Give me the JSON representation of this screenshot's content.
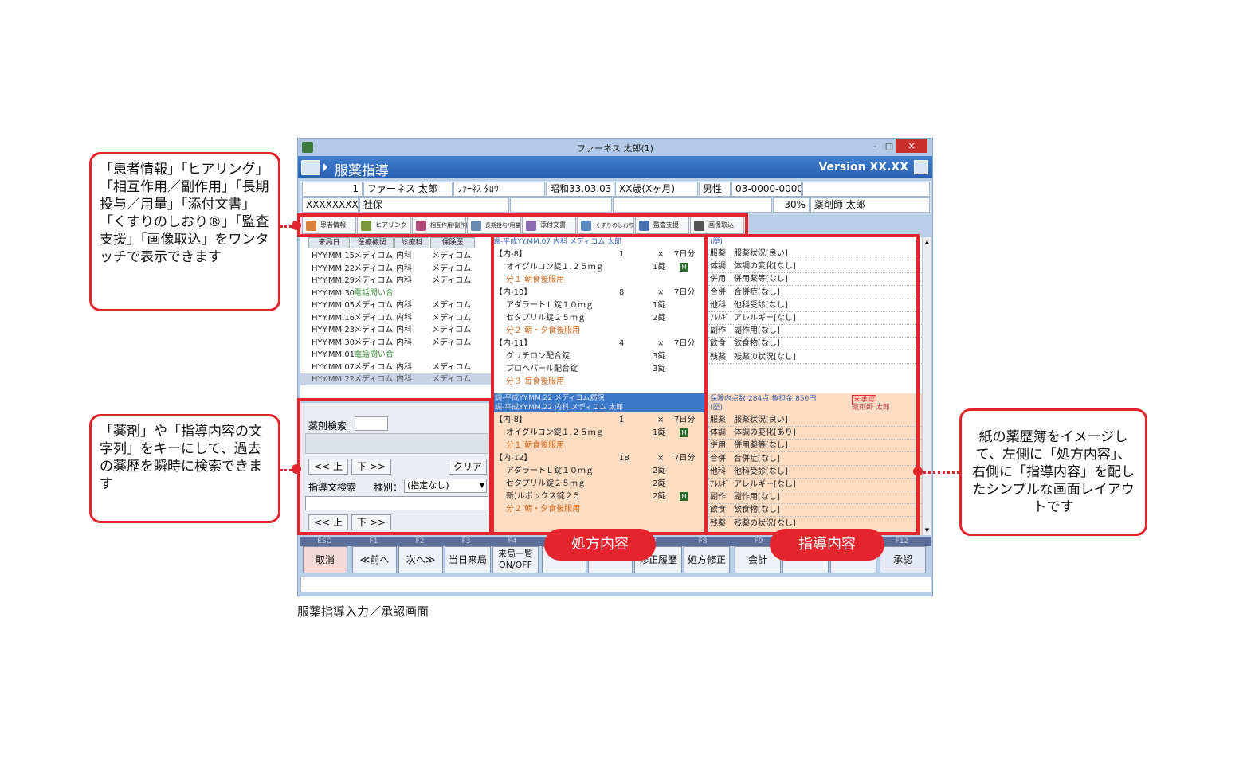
{
  "window": {
    "title": "ファーネス 太郎(1)",
    "screen_title": "服薬指導",
    "version": "Version XX.XX",
    "controls": {
      "minimize": "-",
      "maximize": "□",
      "close": "×"
    }
  },
  "patient": {
    "number": "1",
    "name": "ファーネス 太郎",
    "kana": "ﾌｧｰﾈｽ ﾀﾛｳ",
    "birth": "昭和33.03.03",
    "age": "XX歳(Xヶ月)",
    "sex": "男性",
    "phone": "03-0000-0000",
    "insurer": "XXXXXXXX",
    "insurance_type": "社保",
    "ratio": "30%",
    "pharmacist": "薬剤師 太郎"
  },
  "toolbar": {
    "items": [
      {
        "label": "患者情報",
        "icon": "person-icon",
        "color": "#d9823b"
      },
      {
        "label": "ヒアリング",
        "icon": "pencil-icon",
        "color": "#7a9a3a"
      },
      {
        "label": "相互作用/副作用",
        "icon": "pills-icon",
        "color": "#b04a7a"
      },
      {
        "label": "長期投与/用量",
        "icon": "capsule-icon",
        "color": "#6a8ab0"
      },
      {
        "label": "添付文書",
        "icon": "document-icon",
        "color": "#8a6ab0"
      },
      {
        "label": "くすりのしおり",
        "icon": "leaflet-icon",
        "color": "#5a8ac0"
      },
      {
        "label": "監査支援",
        "icon": "audit-icon",
        "color": "#4a70b0"
      },
      {
        "label": "画像取込",
        "icon": "printer-icon",
        "color": "#555555"
      }
    ]
  },
  "visits": {
    "headers": [
      "来局日",
      "医療機関",
      "診療科",
      "保険医"
    ],
    "rows": [
      {
        "date": "HYY.MM.15",
        "inst": "メディコム",
        "dept": "内科",
        "doctor": "メディコム",
        "kind": "normal"
      },
      {
        "date": "HYY.MM.22",
        "inst": "メディコム",
        "dept": "内科",
        "doctor": "メディコム",
        "kind": "normal"
      },
      {
        "date": "HYY.MM.29",
        "inst": "メディコム",
        "dept": "内科",
        "doctor": "メディコム",
        "kind": "normal"
      },
      {
        "date": "HYY.MM.30",
        "inst": "電話問い合",
        "dept": "",
        "doctor": "",
        "kind": "phone"
      },
      {
        "date": "HYY.MM.05",
        "inst": "メディコム",
        "dept": "内科",
        "doctor": "メディコム",
        "kind": "normal"
      },
      {
        "date": "HYY.MM.16",
        "inst": "メディコム",
        "dept": "内科",
        "doctor": "メディコム",
        "kind": "normal"
      },
      {
        "date": "HYY.MM.23",
        "inst": "メディコム",
        "dept": "内科",
        "doctor": "メディコム",
        "kind": "normal"
      },
      {
        "date": "HYY.MM.30",
        "inst": "メディコム",
        "dept": "内科",
        "doctor": "メディコム",
        "kind": "normal"
      },
      {
        "date": "HYY.MM.01",
        "inst": "電話問い合",
        "dept": "",
        "doctor": "",
        "kind": "phone"
      },
      {
        "date": "HYY.MM.07",
        "inst": "メディコム",
        "dept": "内科",
        "doctor": "メディコム",
        "kind": "normal"
      },
      {
        "date": "HYY.MM.22",
        "inst": "メディコム",
        "dept": "内科",
        "doctor": "メディコム",
        "kind": "selected"
      }
    ]
  },
  "search": {
    "drug_label": "薬剤検索",
    "up": "<< 上",
    "down": "下 >>",
    "clear": "クリア",
    "guidance_label": "指導文検索",
    "kind_label": "種別：",
    "kind_value": "(指定なし)"
  },
  "rx1": {
    "header": "調-平成YY.MM.07 内科 メディコム 太郎",
    "lines": [
      {
        "t": "【内-8】",
        "n": "1",
        "x": "×",
        "d": "7日分",
        "c": "#222"
      },
      {
        "t": "オイグルコン錠１.２５ｍｇ",
        "q": "1錠",
        "mark": "H",
        "c": "#222"
      },
      {
        "t": "分１ 朝食後服用",
        "c": "#d2691e"
      },
      {
        "t": "【内-10】",
        "n": "8",
        "x": "×",
        "d": "7日分",
        "c": "#222"
      },
      {
        "t": "アダラートＬ錠１０ｍｇ",
        "q": "1錠",
        "c": "#222"
      },
      {
        "t": "セタプリル錠２５ｍｇ",
        "q": "2錠",
        "c": "#222"
      },
      {
        "t": "分２ 朝・夕食後服用",
        "c": "#d2691e"
      },
      {
        "t": "【内-11】",
        "n": "4",
        "x": "×",
        "d": "7日分",
        "c": "#222"
      },
      {
        "t": "グリチロン配合錠",
        "q": "3錠",
        "c": "#222"
      },
      {
        "t": "プロヘパール配合錠",
        "q": "3錠",
        "c": "#222"
      },
      {
        "t": "分３ 毎食後服用",
        "c": "#d2691e"
      }
    ]
  },
  "rx2": {
    "header1": "調-平成YY.MM.22 メディコム病院",
    "header2": "調-平成YY.MM.22 内科 メディコム 太郎",
    "lines": [
      {
        "t": "【内-8】",
        "n": "1",
        "x": "×",
        "d": "7日分",
        "c": "#222"
      },
      {
        "t": "オイグルコン錠１.２５ｍｇ",
        "q": "1錠",
        "mark": "H",
        "c": "#222"
      },
      {
        "t": "分１ 朝食後服用",
        "c": "#d2691e"
      },
      {
        "t": "【内-12】",
        "n": "18",
        "x": "×",
        "d": "7日分",
        "c": "#222"
      },
      {
        "t": "アダラートＬ錠１０ｍｇ",
        "q": "2錠",
        "c": "#222"
      },
      {
        "t": "セタプリル錠２５ｍｇ",
        "q": "2錠",
        "c": "#222"
      },
      {
        "t": "新)ルボックス錠２５",
        "q": "2錠",
        "mark": "H",
        "c": "#222"
      },
      {
        "t": "分２ 朝・夕食後服用",
        "c": "#d2691e"
      }
    ]
  },
  "guidance1": {
    "header": "(歴)",
    "rows": [
      {
        "k": "服薬",
        "v": "服薬状況[良い]"
      },
      {
        "k": "体調",
        "v": "体調の変化[なし]"
      },
      {
        "k": "併用",
        "v": "併用薬等[なし]"
      },
      {
        "k": "合併",
        "v": "合併症[なし]"
      },
      {
        "k": "他科",
        "v": "他科受診[なし]"
      },
      {
        "k": "ｱﾚﾙｷﾞ",
        "v": "アレルギー[なし]"
      },
      {
        "k": "副作",
        "v": "副作用[なし]"
      },
      {
        "k": "飲食",
        "v": "飲食物[なし]"
      },
      {
        "k": "残薬",
        "v": "残薬の状況[なし]"
      }
    ]
  },
  "guidance2": {
    "header1": "保険内点数:284点 負担金:850円",
    "header2": "(歴)",
    "status": "未承認",
    "pharmacist": "薬剤師 太郎",
    "rows": [
      {
        "k": "服薬",
        "v": "服薬状況[良い]"
      },
      {
        "k": "体調",
        "v": "体調の変化[あり]"
      },
      {
        "k": "併用",
        "v": "併用薬等[なし]"
      },
      {
        "k": "合併",
        "v": "合併症[なし]"
      },
      {
        "k": "他科",
        "v": "他科受診[なし]"
      },
      {
        "k": "ｱﾚﾙｷﾞ",
        "v": "アレルギー[なし]"
      },
      {
        "k": "副作",
        "v": "副作用[なし]"
      },
      {
        "k": "飲食",
        "v": "飲食物[なし]"
      },
      {
        "k": "残薬",
        "v": "残薬の状況[なし]"
      }
    ]
  },
  "fkeys": {
    "labels": [
      "ESC",
      "F1",
      "F2",
      "F3",
      "F4",
      "F7",
      "F8",
      "F9",
      "F12"
    ],
    "buttons": [
      "取消",
      "≪前へ",
      "次へ≫",
      "当日来局",
      "来局一覧 ON/OFF",
      "修正履歴",
      "処方修正",
      "会計",
      "承認"
    ]
  },
  "annotations": {
    "toolbar_note": "「患者情報」「ヒアリング」「相互作用／副作用」「長期投与／用量」「添付文書」「くすりのしおり®」「監査支援」「画像取込」をワンタッチで表示できます",
    "search_note": "「薬剤」や「指導内容の文字列」をキーにして、過去の薬歴を瞬時に検索できます",
    "layout_note": "紙の薬歴簿をイメージして、左側に「処方内容」、右側に「指導内容」を配したシンプルな画面レイアウトです",
    "rx_pill": "処方内容",
    "guidance_pill": "指導内容",
    "caption": "服薬指導入力／承認画面"
  },
  "colors": {
    "accent": "#e4252d",
    "header_blue": "#2f6bc0",
    "selected_row": "#c7d3e5",
    "peach": "#fcdcc2"
  }
}
